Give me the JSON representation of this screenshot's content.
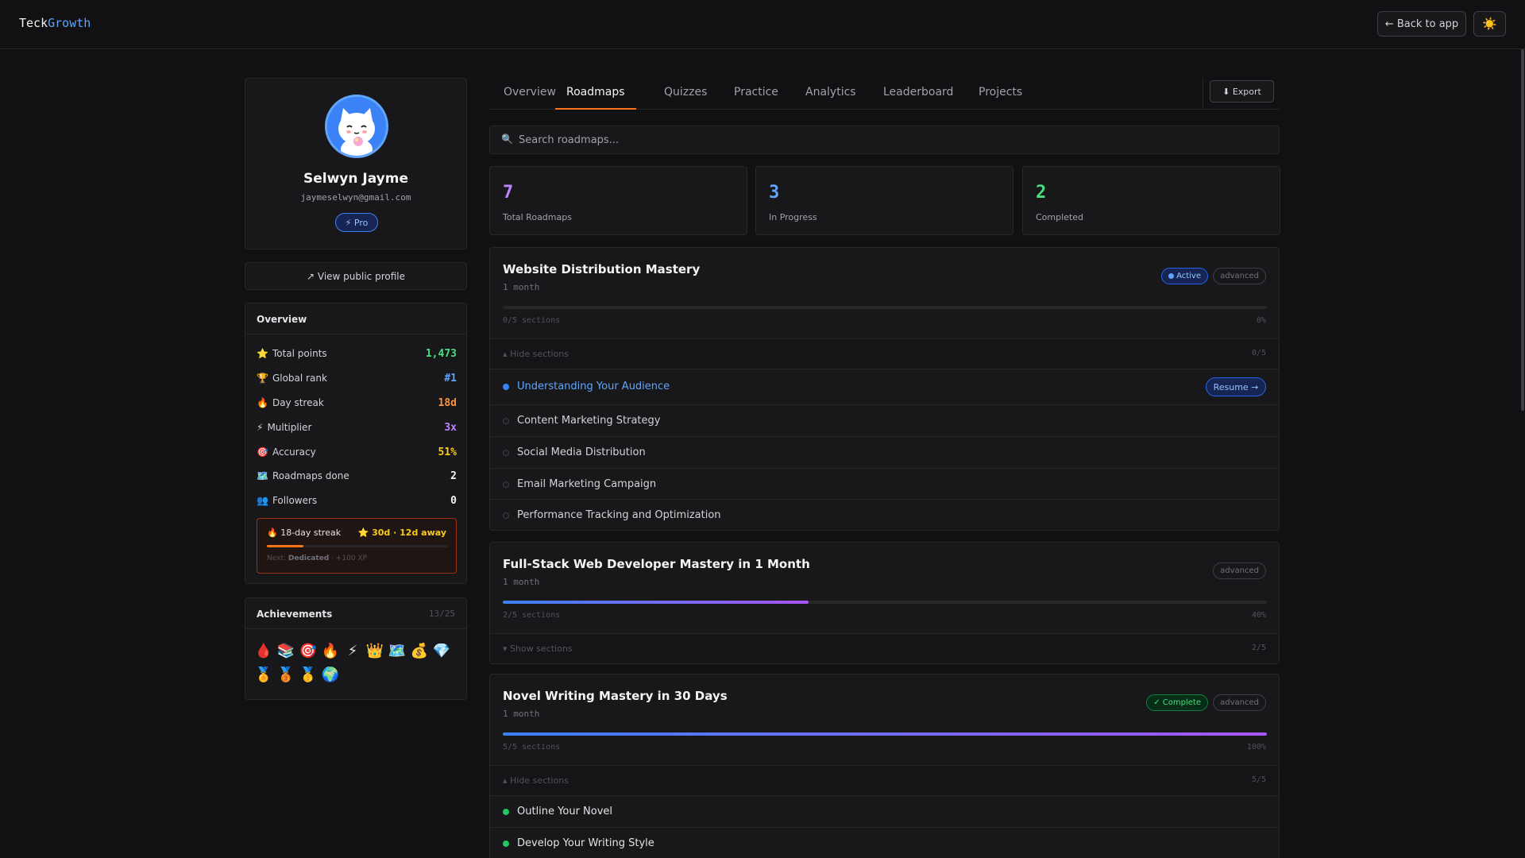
{
  "header": {
    "logo_prefix": "Teck",
    "logo_suffix": "Growth",
    "back_label": "← Back to app",
    "theme_icon": "☀️"
  },
  "profile": {
    "name": "Selwyn Jayme",
    "email": "jaymeselwyn@gmail.com",
    "badge": "⚡ Pro",
    "public_profile": "↗ View public profile"
  },
  "overview": {
    "title": "Overview",
    "stats": [
      {
        "icon": "⭐",
        "label": "Total points",
        "value": "1,473",
        "color": "#4ade80"
      },
      {
        "icon": "🏆",
        "label": "Global rank",
        "value": "#1",
        "color": "#60a5fa"
      },
      {
        "icon": "🔥",
        "label": "Day streak",
        "value": "18d",
        "color": "#fb923c"
      },
      {
        "icon": "⚡",
        "label": "Multiplier",
        "value": "3x",
        "color": "#c084fc"
      },
      {
        "icon": "🎯",
        "label": "Accuracy",
        "value": "51%",
        "color": "#facc15"
      },
      {
        "icon": "🗺️",
        "label": "Roadmaps done",
        "value": "2",
        "color": "#f4f4f5"
      },
      {
        "icon": "👥",
        "label": "Followers",
        "value": "0",
        "color": "#f4f4f5"
      }
    ],
    "streak": {
      "label": "🔥 18-day streak",
      "goal": "⭐ 30d · 12d away",
      "progress": 0.2,
      "next_prefix": "Next:",
      "next_name": "Dedicated",
      "next_suffix": "· +100 XP"
    }
  },
  "achievements": {
    "title": "Achievements",
    "count": "13/25",
    "icons": [
      "🩸",
      "📚",
      "🎯",
      "🔥",
      "⚡",
      "👑",
      "🗺️",
      "💰",
      "💎",
      "🏅",
      "🥉",
      "🥇",
      "🌍"
    ]
  },
  "tabs": [
    "Overview",
    "Roadmaps",
    "Quizzes",
    "Practice",
    "Analytics",
    "Leaderboard",
    "Projects"
  ],
  "active_tab": "Roadmaps",
  "export_label": "⬇ Export",
  "search": {
    "placeholder": "Search roadmaps..."
  },
  "summary": [
    {
      "value": "7",
      "label": "Total Roadmaps",
      "color": "#c084fc"
    },
    {
      "value": "3",
      "label": "In Progress",
      "color": "#60a5fa"
    },
    {
      "value": "2",
      "label": "Completed",
      "color": "#4ade80"
    }
  ],
  "roadmaps": [
    {
      "title": "Website Distribution Mastery",
      "duration": "1 month",
      "status": "Active",
      "level": "advanced",
      "sections_text": "0/5 sections",
      "percent_text": "0%",
      "progress": 0,
      "toggle": "▴ Hide sections",
      "toggle_count": "0/5",
      "sections": [
        {
          "label": "Understanding Your Audience",
          "state": "current",
          "action": "Resume →"
        },
        {
          "label": "Content Marketing Strategy",
          "state": "todo"
        },
        {
          "label": "Social Media Distribution",
          "state": "todo"
        },
        {
          "label": "Email Marketing Campaign",
          "state": "todo"
        },
        {
          "label": "Performance Tracking and Optimization",
          "state": "todo"
        }
      ]
    },
    {
      "title": "Full-Stack Web Developer Mastery in 1 Month",
      "duration": "1 month",
      "level": "advanced",
      "sections_text": "2/5 sections",
      "percent_text": "40%",
      "progress": 0.4,
      "toggle": "▾ Show sections",
      "toggle_count": "2/5"
    },
    {
      "title": "Novel Writing Mastery in 30 Days",
      "duration": "1 month",
      "status": "✓ Complete",
      "level": "advanced",
      "sections_text": "5/5 sections",
      "percent_text": "100%",
      "progress": 1.0,
      "toggle": "▴ Hide sections",
      "toggle_count": "5/5",
      "sections": [
        {
          "label": "Outline Your Novel",
          "state": "done"
        },
        {
          "label": "Develop Your Writing Style",
          "state": "done"
        }
      ]
    }
  ]
}
